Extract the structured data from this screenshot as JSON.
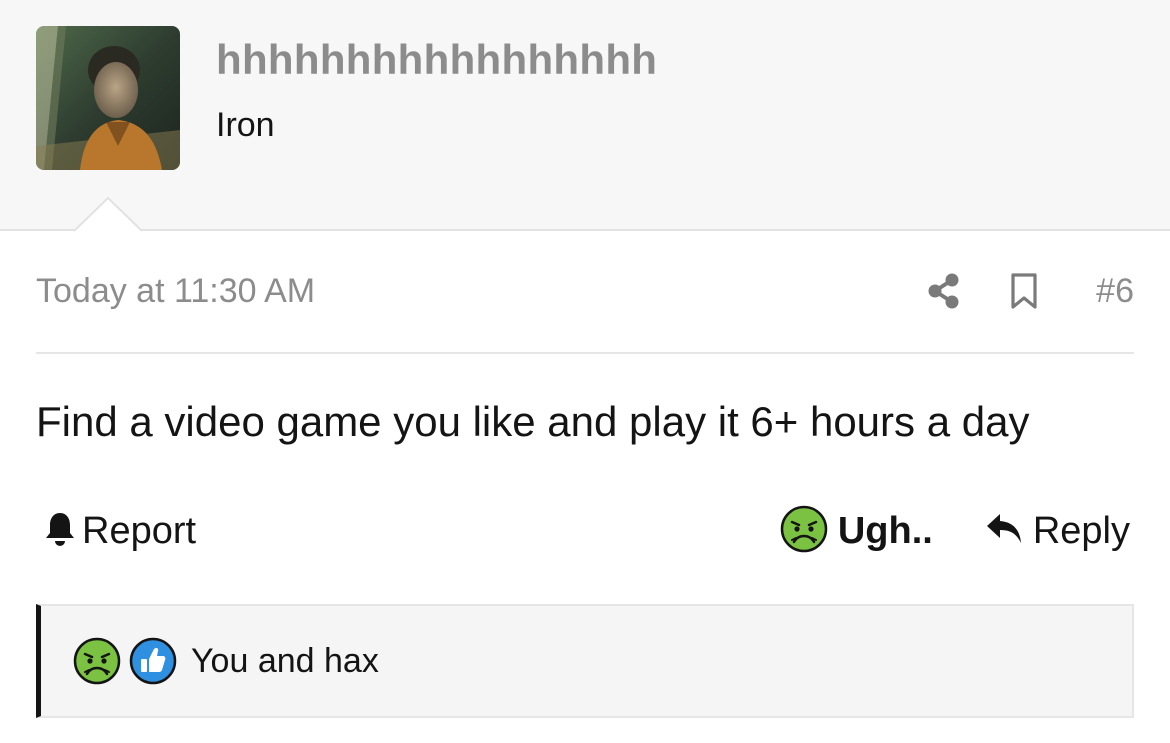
{
  "author": {
    "username": "hhhhhhhhhhhhhhhhh",
    "title": "Iron",
    "avatar": "avatar-photo"
  },
  "post": {
    "date": "Today at 11:30 AM",
    "number": "#6",
    "body": "Find a video game you like and play it 6+ hours a day"
  },
  "actions": {
    "report_label": "Report",
    "reaction_label": "Ugh..",
    "reply_label": "Reply"
  },
  "reactions_summary": {
    "text": "You and hax",
    "icons": [
      "nauseated-face-icon",
      "thumbs-up-icon"
    ]
  },
  "colors": {
    "header_bg": "#f7f7f7",
    "muted_text": "#8c8c8c",
    "text": "#141414",
    "nauseated_green": "#7cc242",
    "like_blue": "#2f8fe0"
  }
}
